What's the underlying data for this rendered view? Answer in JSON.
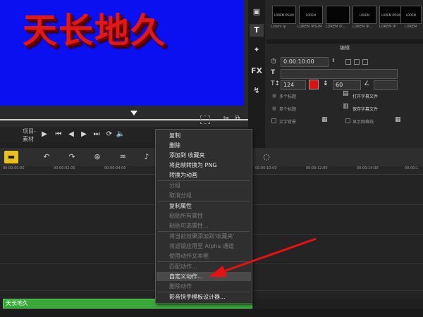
{
  "preview": {
    "title": "天长地久"
  },
  "transport": {
    "mode_project": "项目-",
    "mode_clip": "素材"
  },
  "thumbnails": [
    {
      "text": "LOREM IPSUM",
      "caption": "Lorem ip"
    },
    {
      "text": "LOREM",
      "caption": "LOREM IPSUM"
    },
    {
      "text": "",
      "caption": "LOREM IP..."
    },
    {
      "text": "LOREM",
      "caption": "LOREM IP..."
    },
    {
      "text": "LOREM IPSUM",
      "caption": "LOREM IP"
    },
    {
      "text": "LOREM",
      "caption": "LOREM"
    }
  ],
  "edit_panel": {
    "label": "编辑",
    "timecode": "0:00:10:00",
    "font_size": "124",
    "color_hex": "#e01010",
    "spacing": "60",
    "btn_open_subtitle": "打开字幕文件",
    "btn_save_subtitle": "保存字幕文件",
    "multi_title": "多个标题",
    "single_title": "单个标题",
    "text_background": "文字背景",
    "show_grid": "显示网格线"
  },
  "ruler": [
    "00:00:00:00",
    "00:00:02:00",
    "00:00:04:00",
    "00:00:10:00",
    "00:00:12:00",
    "00:00:14:00",
    "00:00:1"
  ],
  "clip": {
    "label": "天长地久"
  },
  "context_menu": {
    "items": [
      {
        "label": "复制",
        "disabled": false
      },
      {
        "label": "删除",
        "disabled": false
      },
      {
        "label": "添加到 收藏夹",
        "disabled": false
      },
      {
        "label": "将此帧转换为 PNG",
        "disabled": false
      },
      {
        "label": "转换为动画",
        "disabled": false
      },
      {
        "label": "分组",
        "disabled": true
      },
      {
        "label": "取消分组",
        "disabled": true
      },
      {
        "label": "复制属性",
        "disabled": false
      },
      {
        "label": "粘贴所有属性",
        "disabled": true
      },
      {
        "label": "粘贴可选属性...",
        "disabled": true
      },
      {
        "label": "将当前效果添加到'收藏夹'",
        "disabled": true
      },
      {
        "label": "将滤镜应用至 Alpha 通道",
        "disabled": true
      },
      {
        "label": "使用动作文本框",
        "disabled": true
      },
      {
        "label": "匹配动作...",
        "disabled": true
      },
      {
        "label": "自定义动作...",
        "disabled": false,
        "highlighted": true
      },
      {
        "label": "删除动作",
        "disabled": true
      },
      {
        "label": "影音快手模板设计器...",
        "disabled": false
      }
    ]
  },
  "colors": {
    "accent_red": "#e01818",
    "preview_bg": "#0a10f0",
    "clip_green": "#38a838",
    "arrow_red": "#e81010"
  }
}
